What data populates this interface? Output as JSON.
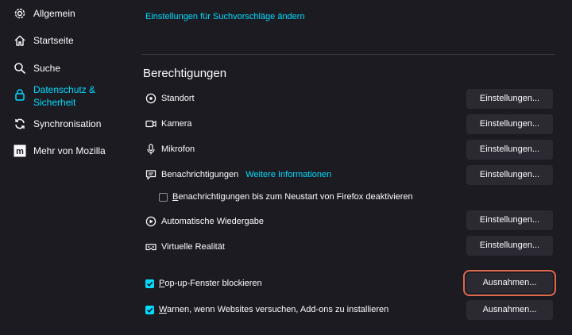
{
  "sidebar": {
    "items": [
      {
        "label": "Allgemein",
        "icon": "gear-icon",
        "active": false
      },
      {
        "label": "Startseite",
        "icon": "home-icon",
        "active": false
      },
      {
        "label": "Suche",
        "icon": "search-icon",
        "active": false
      },
      {
        "label": "Datenschutz & Sicherheit",
        "icon": "lock-icon",
        "active": true
      },
      {
        "label": "Synchronisation",
        "icon": "sync-icon",
        "active": false
      },
      {
        "label": "Mehr von Mozilla",
        "icon": "mozilla-icon",
        "active": false
      }
    ]
  },
  "main": {
    "search_suggestions_link": "Einstellungen für Suchvorschläge ändern",
    "permissions_title": "Berechtigungen",
    "permissions": [
      {
        "label": "Standort",
        "icon": "location-icon",
        "button": "Einstellungen..."
      },
      {
        "label": "Kamera",
        "icon": "camera-icon",
        "button": "Einstellungen..."
      },
      {
        "label": "Mikrofon",
        "icon": "microphone-icon",
        "button": "Einstellungen..."
      },
      {
        "label": "Benachrichtigungen",
        "icon": "notification-icon",
        "button": "Einstellungen...",
        "link": "Weitere Informationen"
      },
      {
        "label": "Automatische Wiedergabe",
        "icon": "autoplay-icon",
        "button": "Einstellungen..."
      },
      {
        "label": "Virtuelle Realität",
        "icon": "vr-icon",
        "button": "Einstellungen..."
      }
    ],
    "pause_notifications": {
      "label_first": "B",
      "label_rest": "enachrichtigungen bis zum Neustart von Firefox deaktivieren",
      "checked": false
    },
    "block_popups": {
      "label_first": "P",
      "label_rest": "op-up-Fenster blockieren",
      "checked": true,
      "button": "Ausnahmen..."
    },
    "warn_addons": {
      "label_first": "W",
      "label_rest": "arnen, wenn Websites versuchen, Add-ons zu installieren",
      "checked": true,
      "button": "Ausnahmen..."
    }
  },
  "colors": {
    "background": "#1c1b22",
    "accent": "#00ddff",
    "button": "#2b2a33",
    "highlight_outline": "#e0694d"
  }
}
